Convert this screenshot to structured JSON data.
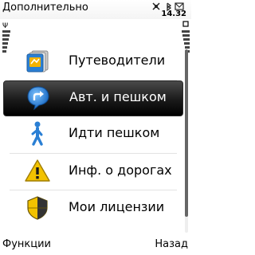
{
  "header": {
    "title": "Дополнительно",
    "clock": "14.32"
  },
  "menu": {
    "items": [
      {
        "label": "Путеводители",
        "icon": "guides-icon",
        "selected": false
      },
      {
        "label": "Авт. и пешком",
        "icon": "drive-walk-icon",
        "selected": true
      },
      {
        "label": "Идти пешком",
        "icon": "walk-icon",
        "selected": false
      },
      {
        "label": "Инф. о дорогах",
        "icon": "traffic-info-icon",
        "selected": false
      },
      {
        "label": "Мои лицензии",
        "icon": "licenses-icon",
        "selected": false
      }
    ]
  },
  "softkeys": {
    "left": "Функции",
    "right": "Назад"
  },
  "colors": {
    "selection": "#1a1a1a",
    "accent_blue": "#2a7fd4",
    "warning_yellow": "#f2c200"
  }
}
